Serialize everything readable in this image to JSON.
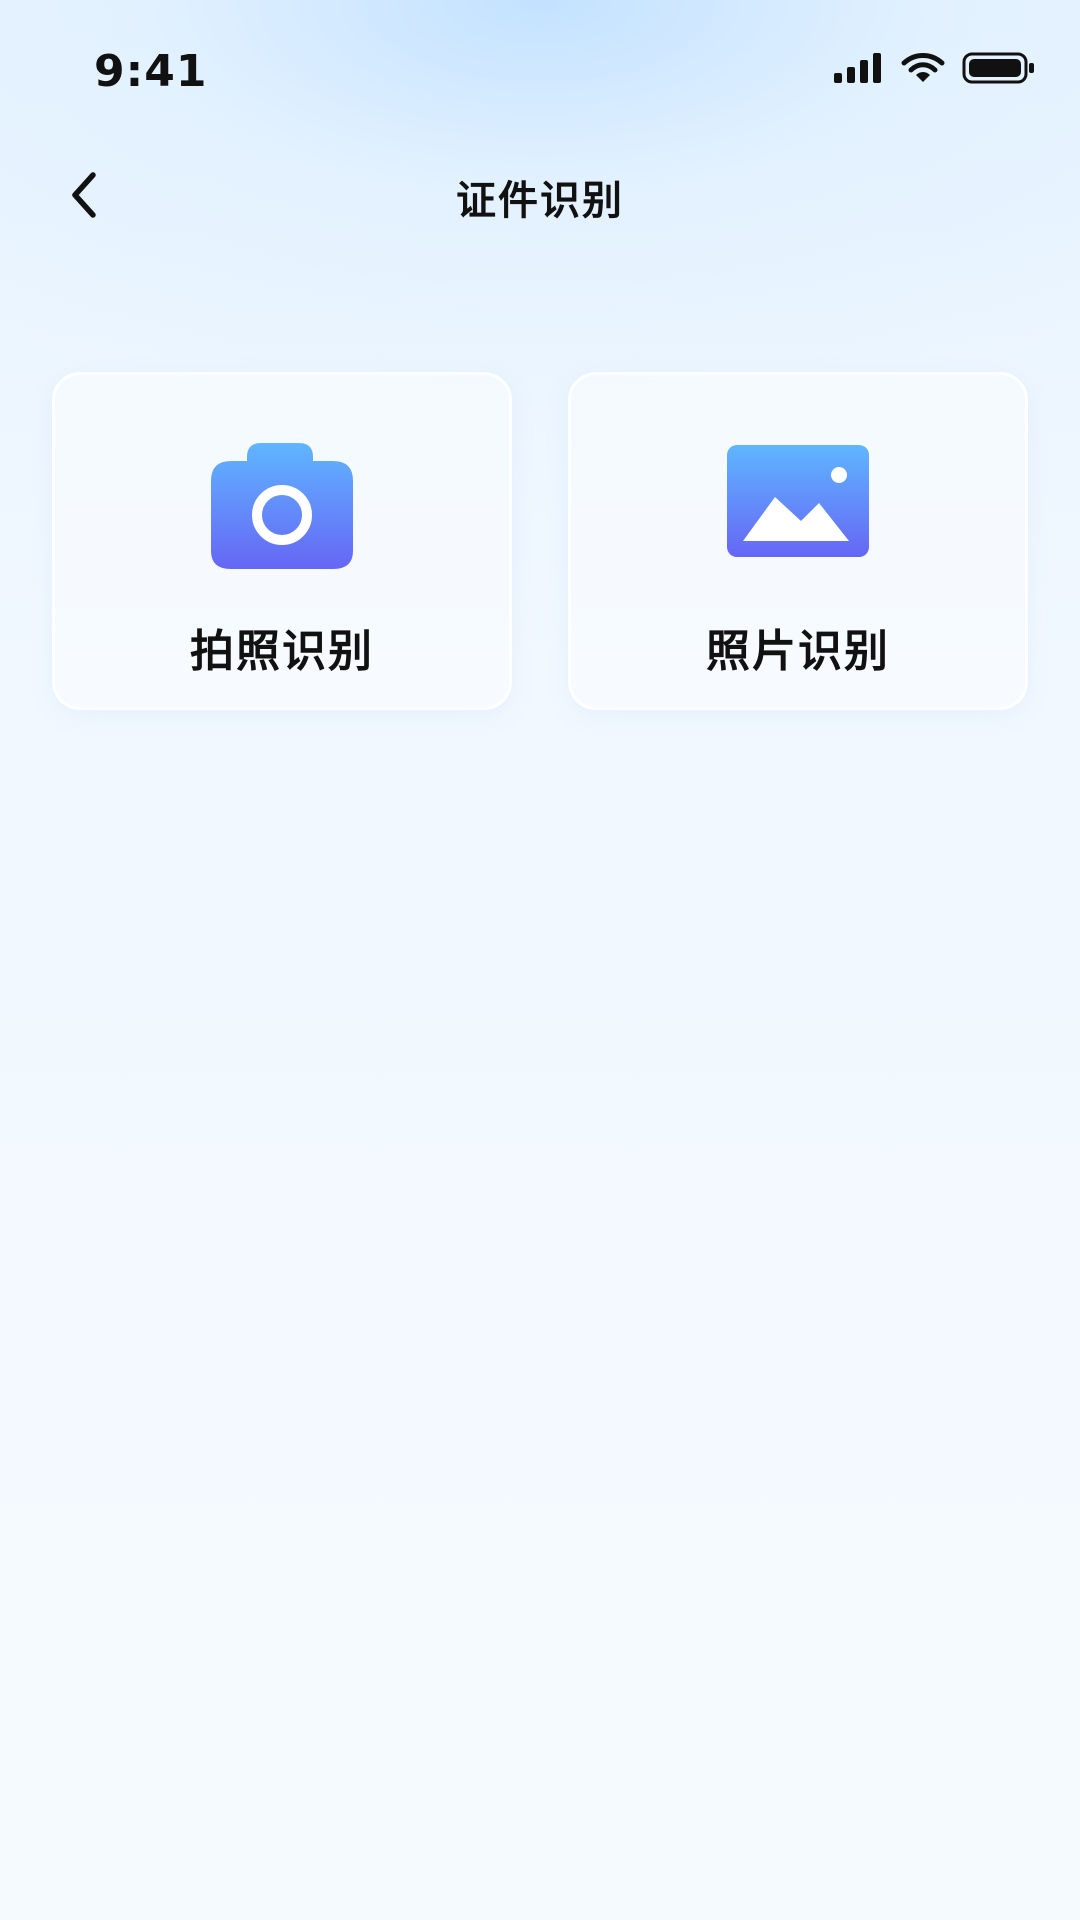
{
  "status_bar": {
    "time": "9:41",
    "icons": [
      "signal-icon",
      "wifi-icon",
      "battery-icon"
    ]
  },
  "nav": {
    "back_icon": "chevron-left-icon",
    "title": "证件识别"
  },
  "options": [
    {
      "label": "拍照识别",
      "icon": "camera-icon"
    },
    {
      "label": "照片识别",
      "icon": "image-icon"
    }
  ],
  "colors": {
    "icon_gradient_top": "#5fb6ff",
    "icon_gradient_bottom": "#6666f5",
    "text": "#111111",
    "background": "#f1f8ff"
  }
}
